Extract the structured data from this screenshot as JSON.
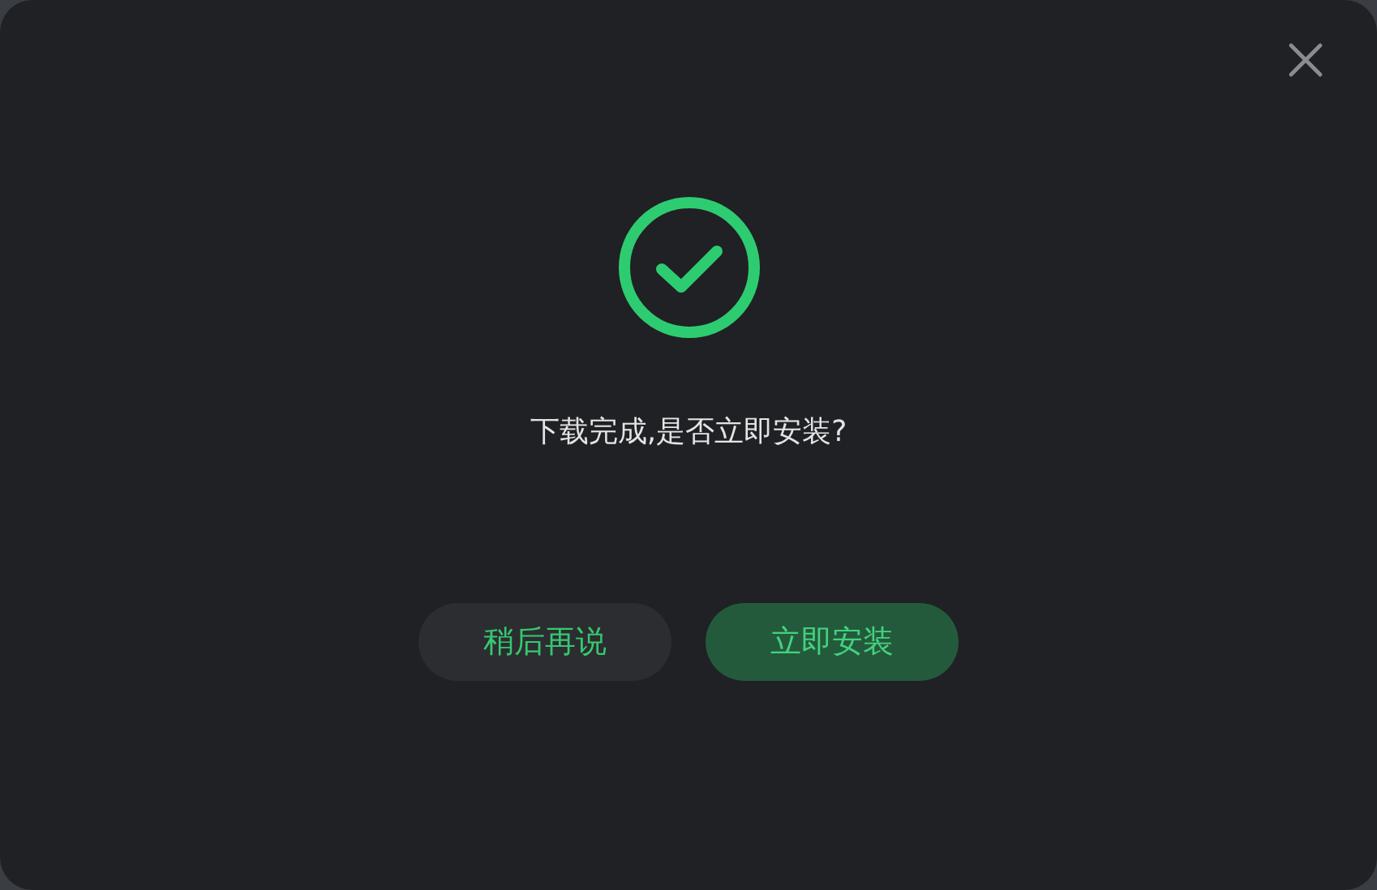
{
  "dialog": {
    "message": "下载完成,是否立即安装?",
    "buttons": [
      {
        "label": "稍后再说",
        "kind": "secondary"
      },
      {
        "label": "立即安装",
        "kind": "primary"
      }
    ]
  }
}
